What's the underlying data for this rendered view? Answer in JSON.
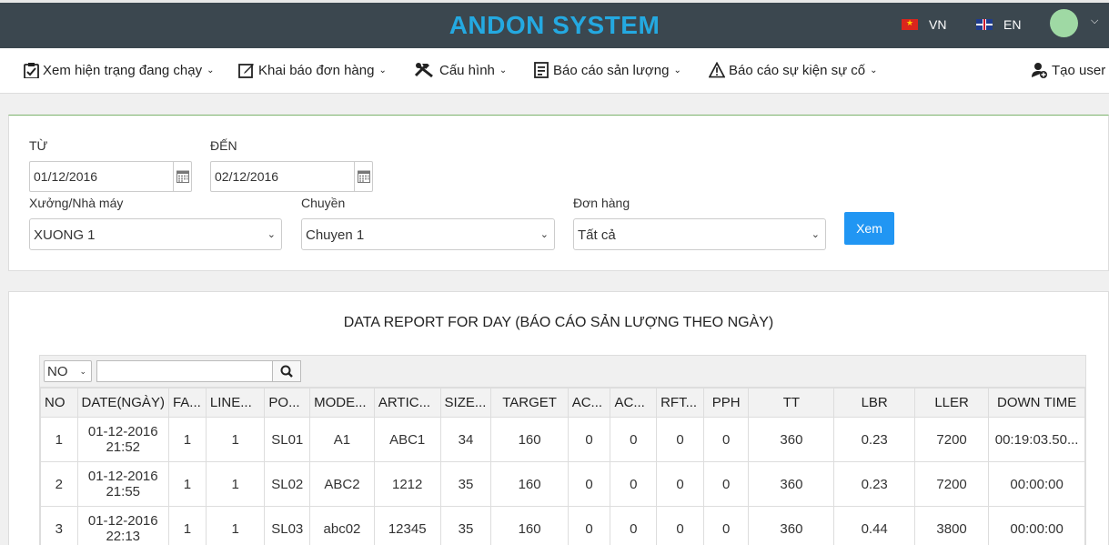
{
  "header": {
    "brand": "ANDON SYSTEM",
    "lang_vn": "VN",
    "lang_en": "EN"
  },
  "nav": {
    "items": [
      {
        "label": "Xem hiện trạng đang chạy"
      },
      {
        "label": "Khai báo đơn hàng"
      },
      {
        "label": "Cấu hình"
      },
      {
        "label": "Báo cáo sản lượng"
      },
      {
        "label": "Báo cáo sự kiện sự cố"
      }
    ],
    "create_user": "Tạo user"
  },
  "filter": {
    "from_label": "TỪ",
    "from_value": "01/12/2016",
    "to_label": "ĐẾN",
    "to_value": "02/12/2016",
    "factory_label": "Xưởng/Nhà máy",
    "factory_value": "XUONG 1",
    "line_label": "Chuyền",
    "line_value": "Chuyen 1",
    "order_label": "Đơn hàng",
    "order_value": "Tất cả",
    "view_button": "Xem"
  },
  "report": {
    "title": "DATA REPORT FOR DAY (BÁO CÁO SẢN LƯỢNG THEO NGÀY)",
    "sort_select": "NO",
    "search_value": "",
    "columns": [
      "NO",
      "DATE(NGÀY)",
      "FA...",
      "LINE...",
      "PO...",
      "MODE...",
      "ARTIC...",
      "SIZE...",
      "TARGET",
      "AC...",
      "AC...",
      "RFT...",
      "PPH",
      "TT",
      "LBR",
      "LLER",
      "DOWN TIME"
    ],
    "rows": [
      [
        "1",
        "01-12-2016 21:52",
        "1",
        "1",
        "SL01",
        "A1",
        "ABC1",
        "34",
        "160",
        "0",
        "0",
        "0",
        "0",
        "360",
        "0.23",
        "7200",
        "00:19:03.50..."
      ],
      [
        "2",
        "01-12-2016 21:55",
        "1",
        "1",
        "SL02",
        "ABC2",
        "1212",
        "35",
        "160",
        "0",
        "0",
        "0",
        "0",
        "360",
        "0.23",
        "7200",
        "00:00:00"
      ],
      [
        "3",
        "01-12-2016 22:13",
        "1",
        "1",
        "SL03",
        "abc02",
        "12345",
        "35",
        "160",
        "0",
        "0",
        "0",
        "0",
        "360",
        "0.44",
        "3800",
        "00:00:00"
      ]
    ]
  }
}
